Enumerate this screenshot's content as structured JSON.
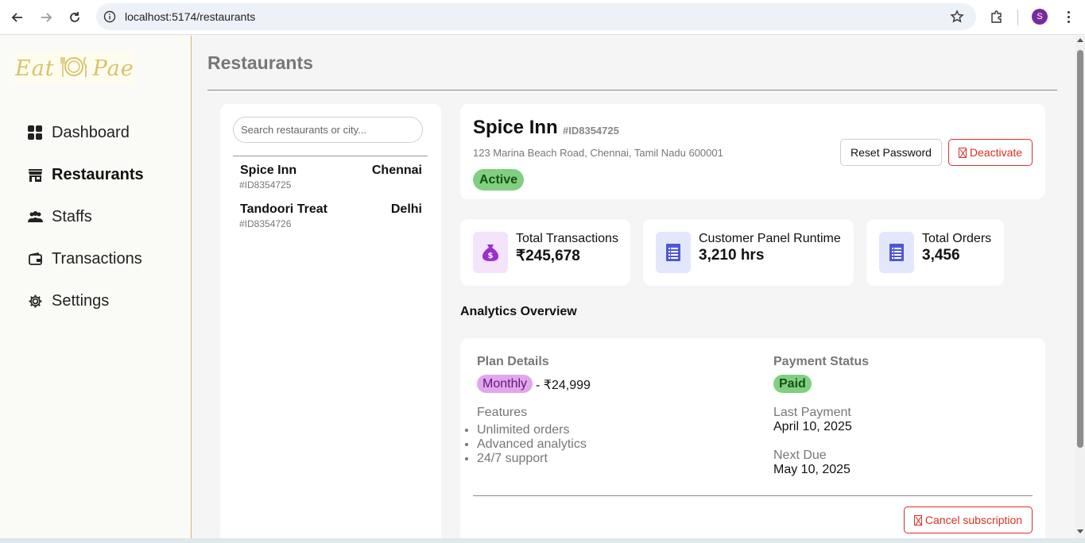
{
  "browser": {
    "url": "localhost:5174/restaurants",
    "profile_initial": "S"
  },
  "sidebar": {
    "logo_text_left": "Eat",
    "logo_text_right": "Pae",
    "items": [
      {
        "label": "Dashboard",
        "icon": "dashboard-icon",
        "active": false
      },
      {
        "label": "Restaurants",
        "icon": "store-icon",
        "active": true
      },
      {
        "label": "Staffs",
        "icon": "people-icon",
        "active": false
      },
      {
        "label": "Transactions",
        "icon": "wallet-icon",
        "active": false
      },
      {
        "label": "Settings",
        "icon": "gear-icon",
        "active": false
      }
    ]
  },
  "page": {
    "title": "Restaurants"
  },
  "list": {
    "search_placeholder": "Search restaurants or city...",
    "restaurants": [
      {
        "name": "Spice Inn",
        "city": "Chennai",
        "id": "#ID8354725"
      },
      {
        "name": "Tandoori Treat",
        "city": "Delhi",
        "id": "#ID8354726"
      }
    ]
  },
  "detail": {
    "name": "Spice Inn",
    "id": "#ID8354725",
    "address": "123 Marina Beach Road, Chennai, Tamil Nadu 600001",
    "status": "Active",
    "reset_label": "Reset Password",
    "deactivate_label": "Deactivate"
  },
  "stats": [
    {
      "label": "Total Transactions",
      "value": "₹245,678",
      "icon": "money-bag-icon",
      "icon_bg": "#f3e3fb",
      "icon_color": "#9a2fd0"
    },
    {
      "label": "Customer Panel Runtime",
      "value": "3,210 hrs",
      "icon": "document-icon",
      "icon_bg": "#e3e7fb",
      "icon_color": "#4f57d6"
    },
    {
      "label": "Total Orders",
      "value": "3,456",
      "icon": "document-icon",
      "icon_bg": "#e3e7fb",
      "icon_color": "#4f57d6"
    }
  ],
  "analytics": {
    "title": "Analytics Overview",
    "plan_heading": "Plan Details",
    "plan_badge": "Monthly",
    "plan_price": "- ₹24,999",
    "features_heading": "Features",
    "features": [
      "Unlimited orders",
      "Advanced analytics",
      "24/7 support"
    ],
    "payment_heading": "Payment Status",
    "payment_status": "Paid",
    "last_payment_label": "Last Payment",
    "last_payment_value": "April 10, 2025",
    "next_due_label": "Next Due",
    "next_due_value": "May 10, 2025",
    "cancel_label": "Cancel subscription"
  },
  "colors": {
    "accent_red": "#d93025",
    "active_green": "#81cf81",
    "monthly_purple": "#e2a6ec",
    "sidebar_border": "#d6b47a"
  }
}
